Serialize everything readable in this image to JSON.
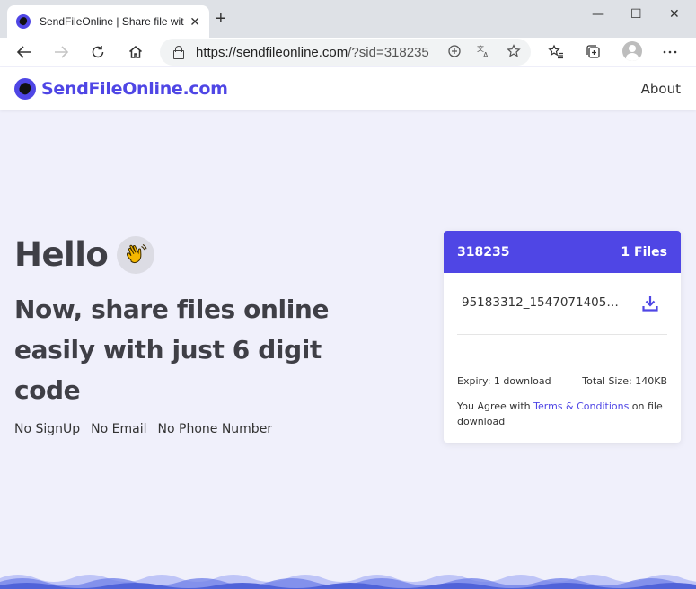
{
  "browser": {
    "tab_title": "SendFileOnline | Share file with 6",
    "tab_close": "✕",
    "new_tab": "+",
    "url_host": "https://sendfileonline.com",
    "url_rest": "/?sid=318235",
    "window_controls": [
      "—",
      "☐",
      "✕"
    ],
    "toolbar_icons": [
      "back-icon",
      "forward-icon",
      "refresh-icon",
      "home-icon",
      "add-icon",
      "translate-icon",
      "star-icon",
      "favorites-icon",
      "collections-icon",
      "profile-icon",
      "more-icon"
    ]
  },
  "site": {
    "logo_text": "SendFileOnline.com",
    "nav_about": "About",
    "brand_color": "#4f46e5"
  },
  "hero": {
    "hello": "Hello",
    "headline": "Now, share files online easily with just 6 digit code",
    "features": [
      "No SignUp",
      "No Email",
      "No Phone Number"
    ]
  },
  "card": {
    "code": "318235",
    "files_count": "1 Files",
    "file_name": "95183312_15470714054...",
    "expiry": "Expiry: 1 download",
    "total_size": "Total Size: 140KB",
    "agree_prefix": "You Agree with ",
    "terms_link": "Terms & Conditions",
    "agree_suffix": " on file download"
  }
}
